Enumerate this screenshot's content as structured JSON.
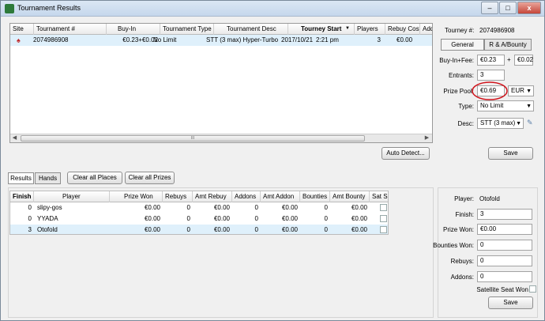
{
  "window": {
    "title": "Tournament Results",
    "minimize": "–",
    "maximize": "□",
    "close": "x"
  },
  "tournaments": {
    "columns": [
      "Site",
      "Tournament #",
      "Buy-In",
      "Tournament Type",
      "Tournament Desc",
      "Tourney Start",
      "Players",
      "Rebuy Cost",
      "Addons"
    ],
    "rows": [
      {
        "tournament": "2074986908",
        "buyin": "€0.23+€0.02",
        "type": "No Limit",
        "desc": "STT (3 max) Hyper-Turbo",
        "date": "2017/10/21",
        "time": "2:21 pm",
        "players": "3",
        "rebuy": "€0.00"
      }
    ],
    "scroll_marker": "III"
  },
  "auto_detect_label": "Auto Detect...",
  "details": {
    "tourney_label": "Tourney #:",
    "tourney_value": "2074986908",
    "tab_general": "General",
    "tab_bounty": "R & A/Bounty",
    "buyin_label": "Buy-In+Fee:",
    "buyin_value": "€0.23",
    "plus": "+",
    "fee_value": "€0.02",
    "entrants_label": "Entrants:",
    "entrants_value": "3",
    "prizepool_label": "Prize Pool:",
    "prizepool_value": "€0.69",
    "currency": "EUR",
    "type_label": "Type:",
    "type_value": "No Limit",
    "desc_label": "Desc:",
    "desc_value": "STT (3 max)",
    "save_label": "Save"
  },
  "tabs": {
    "results": "Results",
    "hands": "Hands",
    "clear_places": "Clear all Places",
    "clear_prizes": "Clear all Prizes"
  },
  "results": {
    "columns": [
      "Finish",
      "Player",
      "Prize Won",
      "Rebuys",
      "Amt Rebuy",
      "Addons",
      "Amt Addon",
      "Bounties",
      "Amt Bounty",
      "Sat Seat"
    ],
    "rows": [
      {
        "finish": "0",
        "player": "slipy-gos",
        "prize": "€0.00",
        "rebuys": "0",
        "amt_rebuy": "€0.00",
        "addons": "0",
        "amt_addon": "€0.00",
        "bounties": "0",
        "amt_bounty": "€0.00"
      },
      {
        "finish": "0",
        "player": "YYADA",
        "prize": "€0.00",
        "rebuys": "0",
        "amt_rebuy": "€0.00",
        "addons": "0",
        "amt_addon": "€0.00",
        "bounties": "0",
        "amt_bounty": "€0.00"
      },
      {
        "finish": "3",
        "player": "Otofold",
        "prize": "€0.00",
        "rebuys": "0",
        "amt_rebuy": "€0.00",
        "addons": "0",
        "amt_addon": "€0.00",
        "bounties": "0",
        "amt_bounty": "€0.00"
      }
    ]
  },
  "player_details": {
    "player_label": "Player:",
    "player_value": "Otofold",
    "finish_label": "Finish:",
    "finish_value": "3",
    "prize_label": "Prize Won:",
    "prize_value": "€0.00",
    "bounties_label": "Bounties Won:",
    "bounties_value": "0",
    "rebuys_label": "Rebuys:",
    "rebuys_value": "0",
    "addons_label": "Addons:",
    "addons_value": "0",
    "satellite_label": "Satellite Seat Won",
    "save_label": "Save"
  },
  "colors": {
    "selected_row": "#dff0fb",
    "annotation_circle": "#d0141c"
  }
}
